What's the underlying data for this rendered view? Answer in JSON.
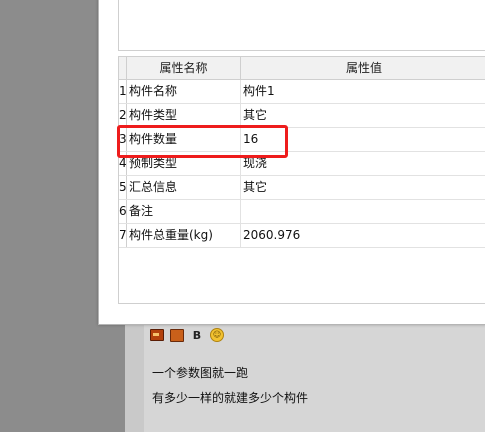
{
  "table": {
    "headers": {
      "name": "属性名称",
      "value": "属性值"
    },
    "rows": [
      {
        "index": "1",
        "name": "构件名称",
        "value": "构件1"
      },
      {
        "index": "2",
        "name": "构件类型",
        "value": "其它"
      },
      {
        "index": "3",
        "name": "构件数量",
        "value": "16"
      },
      {
        "index": "4",
        "name": "预制类型",
        "value": "现浇"
      },
      {
        "index": "5",
        "name": "汇总信息",
        "value": "其它"
      },
      {
        "index": "6",
        "name": "备注",
        "value": ""
      },
      {
        "index": "7",
        "name": "构件总重量(kg)",
        "value": "2060.976"
      }
    ]
  },
  "editor": {
    "toolbar": {
      "bold_label": "B",
      "emoji_glyph": "☺"
    },
    "lines": [
      "一个参数图就一跑",
      "有多少一样的就建多少个构件"
    ]
  },
  "colors": {
    "highlight": "#ee1c1c"
  }
}
